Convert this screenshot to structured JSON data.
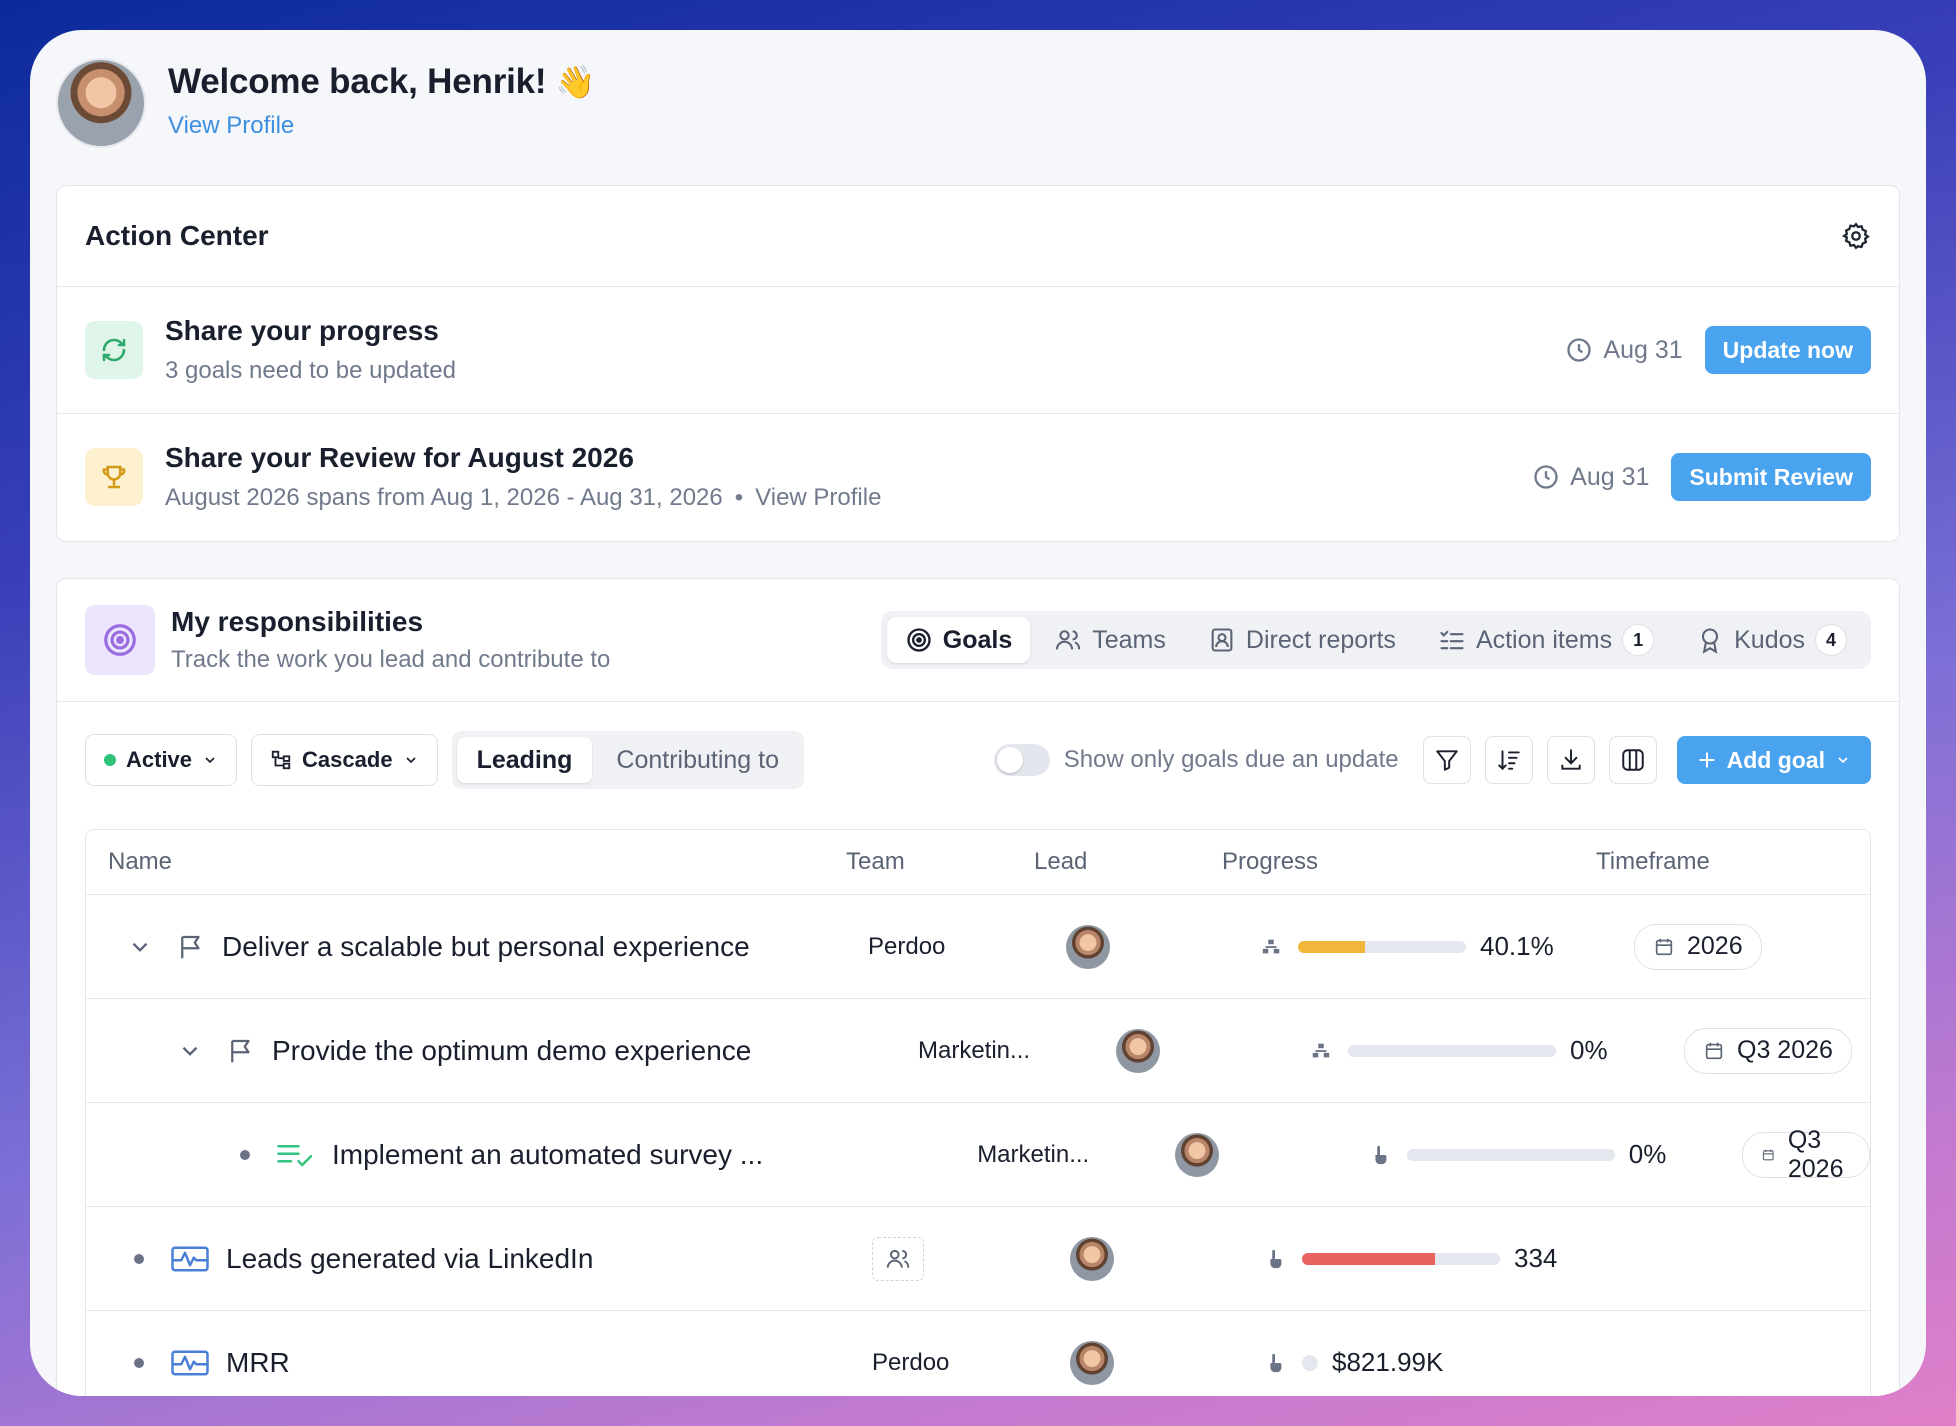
{
  "header": {
    "welcome": "Welcome back, Henrik!",
    "wave": "👋",
    "view_profile": "View Profile"
  },
  "action_center": {
    "title": "Action Center",
    "items": [
      {
        "title": "Share your progress",
        "subtitle": "3 goals need to be updated",
        "due": "Aug 31",
        "button": "Update now"
      },
      {
        "title": "Share your Review for August 2026",
        "subtitle": "August 2026 spans from Aug 1, 2026 - Aug 31, 2026",
        "sep": "•",
        "link": "View Profile",
        "due": "Aug 31",
        "button": "Submit Review"
      }
    ]
  },
  "responsibilities": {
    "title": "My responsibilities",
    "subtitle": "Track the work you lead and contribute to",
    "tabs": [
      {
        "label": "Goals"
      },
      {
        "label": "Teams"
      },
      {
        "label": "Direct reports"
      },
      {
        "label": "Action items",
        "count": "1"
      },
      {
        "label": "Kudos",
        "count": "4"
      }
    ]
  },
  "toolbar": {
    "status": "Active",
    "view": "Cascade",
    "seg": [
      "Leading",
      "Contributing to"
    ],
    "toggle_label": "Show only goals due an update",
    "add_goal": "Add goal"
  },
  "table": {
    "headers": [
      "Name",
      "Team",
      "Lead",
      "Progress",
      "Timeframe"
    ],
    "rows": [
      {
        "name": "Deliver a scalable but personal experience",
        "team": "Perdoo",
        "progress": 40.1,
        "progress_label": "40.1%",
        "timeframe": "2026"
      },
      {
        "name": "Provide the optimum demo experience",
        "team": "Marketin...",
        "progress": 0,
        "progress_label": "0%",
        "timeframe": "Q3 2026"
      },
      {
        "name": "Implement an automated survey ...",
        "team": "Marketin...",
        "progress": 0,
        "progress_label": "0%",
        "timeframe": "Q3 2026"
      },
      {
        "name": "Leads generated via LinkedIn",
        "team": "",
        "progress": 67,
        "progress_label": "334",
        "timeframe": ""
      },
      {
        "name": "MRR",
        "team": "Perdoo",
        "progress": 0,
        "progress_label": "$821.99K",
        "timeframe": ""
      }
    ]
  },
  "colors": {
    "accent": "#4aa3ee",
    "progress_yellow": "#f2b63a",
    "progress_red": "#e8625f"
  }
}
